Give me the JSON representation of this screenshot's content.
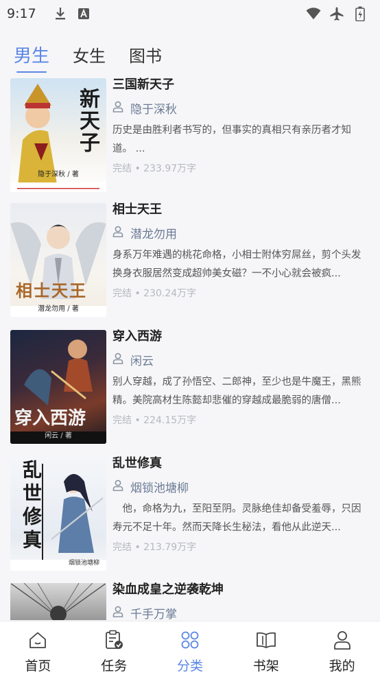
{
  "status_bar": {
    "time": "9:17",
    "icons": [
      "download-icon",
      "a-icon",
      "wifi-icon",
      "airplane-icon",
      "battery-icon"
    ]
  },
  "tabs": [
    {
      "label": "男生",
      "active": true
    },
    {
      "label": "女生",
      "active": false
    },
    {
      "label": "图书",
      "active": false
    }
  ],
  "books": [
    {
      "title": "三国新天子",
      "author": "隐于深秋",
      "description": "历史是由胜利者书写的，但事实的真相只有亲历者才知道。 ...",
      "status": "完结",
      "words": "233.97万字",
      "cover_title": "新天子",
      "cover_author": "隐于深秋 / 著"
    },
    {
      "title": "相士天王",
      "author": "潜龙勿用",
      "description": "身系万年难遇的桃花命格，小相士附体穷屌丝，剪个头发换身衣服居然变成超帅美女磁？一不小心就会被疯...",
      "status": "完结",
      "words": "230.24万字",
      "cover_title": "相士天王",
      "cover_author": "潜龙勿用 / 著"
    },
    {
      "title": "穿入西游",
      "author": "闲云",
      "description": "别人穿越，成了孙悟空、二郎神，至少也是牛魔王，黑熊精。美院高材生陈懿却悲催的穿越成最脆弱的唐僧...",
      "status": "完结",
      "words": "224.15万字",
      "cover_title": "穿入西游",
      "cover_author": "闲云 / 著"
    },
    {
      "title": "乱世修真",
      "author": "烟锁池塘柳",
      "description": "　他，命格为九，至阳至阴。灵脉绝佳却备受羞辱，只因寿元不足十年。然而天降长生秘法，看他从此逆天...",
      "status": "完结",
      "words": "213.79万字",
      "cover_title": "乱世修真",
      "cover_author": "烟锁池塘柳"
    },
    {
      "title": "染血成皇之逆袭乾坤",
      "author": "千手万掌",
      "description": "",
      "status": "",
      "words": "",
      "cover_title": "",
      "cover_author": ""
    }
  ],
  "bottom_nav": [
    {
      "label": "首页",
      "icon": "home-icon",
      "active": false
    },
    {
      "label": "任务",
      "icon": "task-icon",
      "active": false
    },
    {
      "label": "分类",
      "icon": "category-icon",
      "active": true
    },
    {
      "label": "书架",
      "icon": "bookshelf-icon",
      "active": false
    },
    {
      "label": "我的",
      "icon": "profile-icon",
      "active": false
    }
  ],
  "colors": {
    "accent": "#5b86e5",
    "background": "#f6f6f8",
    "author_text": "#6b7b95",
    "meta_text": "#b4b8c0"
  }
}
